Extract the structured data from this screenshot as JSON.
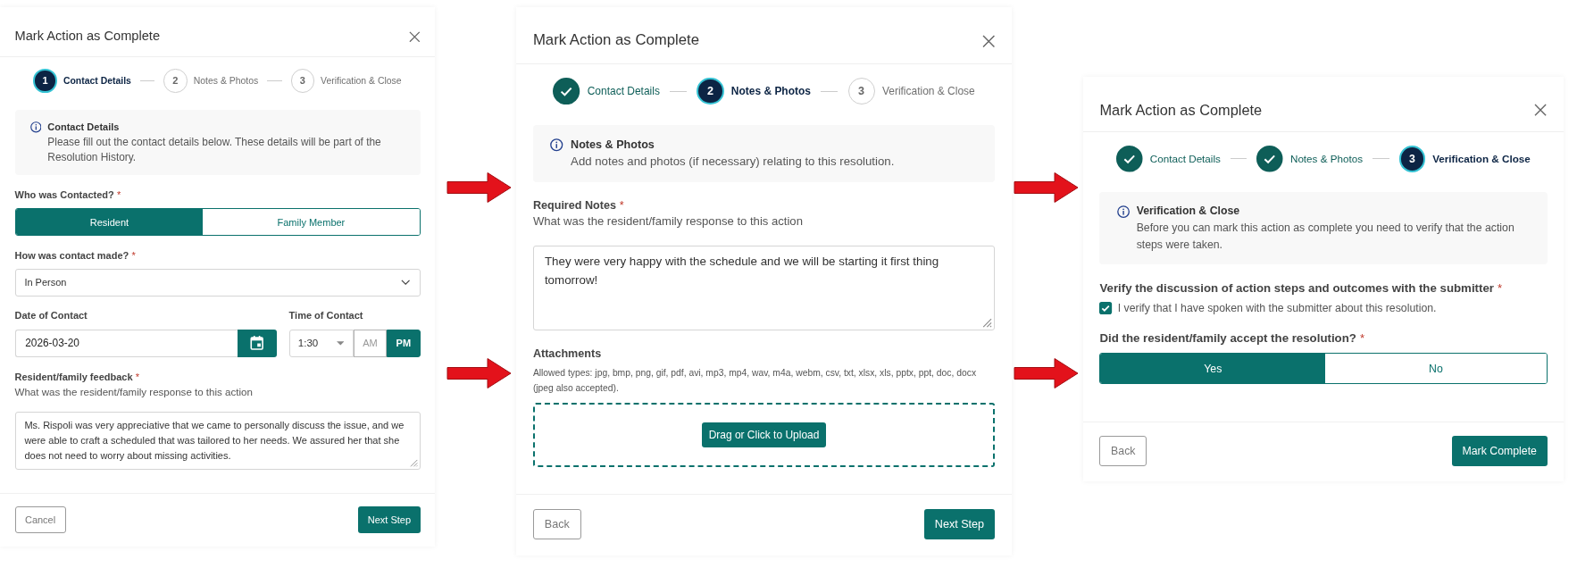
{
  "panels": [
    {
      "title": "Mark Action as Complete",
      "steps": [
        {
          "number": "1",
          "label": "Contact Details",
          "completed": false,
          "current": true
        },
        {
          "number": "2",
          "label": "Notes & Photos",
          "completed": false,
          "current": false
        },
        {
          "number": "3",
          "label": "Verification & Close",
          "completed": false,
          "current": false
        }
      ],
      "info": {
        "title": "Contact Details",
        "text": "Please fill out the contact details below. These details will be part of the Resolution History."
      },
      "fields": [
        {
          "kind": "toggle",
          "label": "Who was Contacted?",
          "required_mark": "*",
          "options": [
            {
              "label": "Resident",
              "selected": true
            },
            {
              "label": "Family Member",
              "selected": false
            }
          ]
        },
        {
          "kind": "select",
          "label": "How was contact made?",
          "required_mark": "*",
          "value": "In Person"
        },
        {
          "kind": "date_time",
          "date": {
            "label": "Date of Contact",
            "value": "2026-03-20"
          },
          "time": {
            "label": "Time of Contact",
            "value": "1:30",
            "periods": [
              {
                "label": "AM",
                "selected": false
              },
              {
                "label": "PM",
                "selected": true
              }
            ]
          }
        },
        {
          "kind": "textarea",
          "label": "Resident/family feedback",
          "required_mark": "*",
          "hint": "What was the resident/family response to this action",
          "value": "Ms. Rispoli was very appreciative that we came to personally discuss the issue, and we were able to craft a scheduled that was tailored to her needs. We assured her that she does not need to worry about missing activities."
        }
      ],
      "buttons": [
        {
          "label": "Cancel",
          "kind": "secondary"
        },
        {
          "label": "Next Step",
          "kind": "primary"
        }
      ]
    },
    {
      "title": "Mark Action as Complete",
      "steps": [
        {
          "label": "Contact Details",
          "completed": true,
          "current": false
        },
        {
          "number": "2",
          "label": "Notes & Photos",
          "completed": false,
          "current": true
        },
        {
          "number": "3",
          "label": "Verification & Close",
          "completed": false,
          "current": false
        }
      ],
      "info": {
        "title": "Notes & Photos",
        "text": "Add notes and photos (if necessary) relating to this resolution."
      },
      "fields": [
        {
          "kind": "textarea",
          "label": "Required Notes",
          "required_mark": "*",
          "hint": "What was the resident/family response to this action",
          "value": "They were very happy with the schedule and we will be starting it first thing tomorrow!"
        },
        {
          "kind": "attachments",
          "label": "Attachments",
          "allowed": "Allowed types: jpg, bmp, png, gif, pdf, avi, mp3, mp4, wav, m4a, webm, csv, txt, xlsx, xls, pptx, ppt, doc, docx (jpeg also accepted).",
          "button": "Drag or Click to Upload"
        }
      ],
      "buttons": [
        {
          "label": "Back",
          "kind": "secondary"
        },
        {
          "label": "Next Step",
          "kind": "primary"
        }
      ]
    },
    {
      "title": "Mark Action as Complete",
      "steps": [
        {
          "label": "Contact Details",
          "completed": true,
          "current": false
        },
        {
          "label": "Notes & Photos",
          "completed": true,
          "current": false
        },
        {
          "number": "3",
          "label": "Verification & Close",
          "completed": false,
          "current": true
        }
      ],
      "info": {
        "title": "Verification & Close",
        "text": "Before you can mark this action as complete you need to verify that the action steps were taken."
      },
      "fields": [
        {
          "kind": "checkbox",
          "label": "Verify the discussion of action steps and outcomes with the submitter",
          "required_mark": "*",
          "option": "I verify that I have spoken with the submitter about this resolution.",
          "checked": true
        },
        {
          "kind": "toggle",
          "label": "Did the resident/family accept the resolution?",
          "required_mark": "*",
          "options": [
            {
              "label": "Yes",
              "selected": true
            },
            {
              "label": "No",
              "selected": false
            }
          ]
        }
      ],
      "buttons": [
        {
          "label": "Back",
          "kind": "secondary"
        },
        {
          "label": "Mark Complete",
          "kind": "primary"
        }
      ]
    }
  ]
}
